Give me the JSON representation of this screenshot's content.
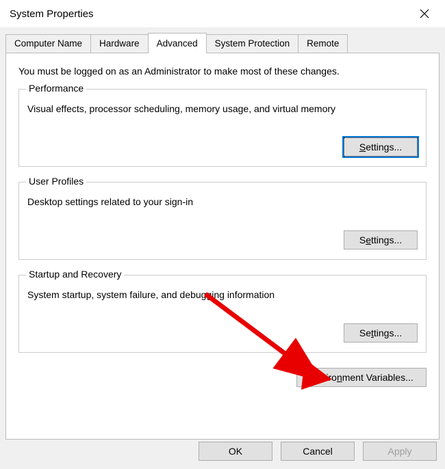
{
  "window": {
    "title": "System Properties"
  },
  "tabs": {
    "computer_name": "Computer Name",
    "hardware": "Hardware",
    "advanced": "Advanced",
    "system_protection": "System Protection",
    "remote": "Remote"
  },
  "panel": {
    "admin_note": "You must be logged on as an Administrator to make most of these changes."
  },
  "performance": {
    "legend": "Performance",
    "desc": "Visual effects, processor scheduling, memory usage, and virtual memory"
  },
  "user_profiles": {
    "legend": "User Profiles",
    "desc": "Desktop settings related to your sign-in"
  },
  "startup": {
    "legend": "Startup and Recovery",
    "desc": "System startup, system failure, and debugging information"
  },
  "buttons": {
    "ok": "OK",
    "cancel": "Cancel",
    "apply": "Apply"
  }
}
